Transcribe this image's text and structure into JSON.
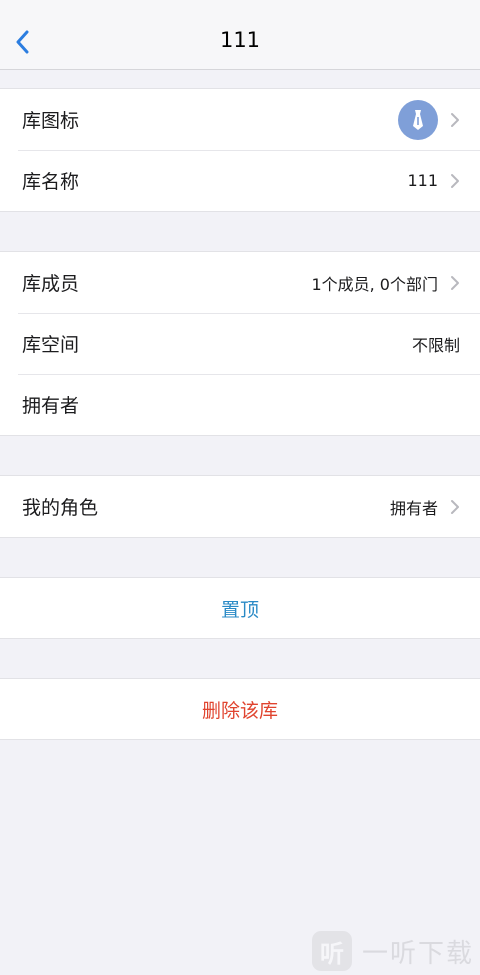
{
  "header": {
    "title": "111",
    "back_icon": "chevron-left-icon"
  },
  "group1": {
    "icon_row": {
      "label": "库图标",
      "icon": "tie-icon",
      "icon_bg": "#7f9fd8"
    },
    "name_row": {
      "label": "库名称",
      "value": "111"
    }
  },
  "group2": {
    "members_row": {
      "label": "库成员",
      "value": "1个成员, 0个部门"
    },
    "space_row": {
      "label": "库空间",
      "value": "不限制"
    },
    "owner_row": {
      "label": "拥有者",
      "value": ""
    }
  },
  "group3": {
    "role_row": {
      "label": "我的角色",
      "value": "拥有者"
    }
  },
  "actions": {
    "pin_label": "置顶",
    "pin_color": "#2a8ac6",
    "delete_label": "删除该库",
    "delete_color": "#e0442f"
  },
  "watermark": {
    "logo": "听",
    "text": "一听下载"
  }
}
